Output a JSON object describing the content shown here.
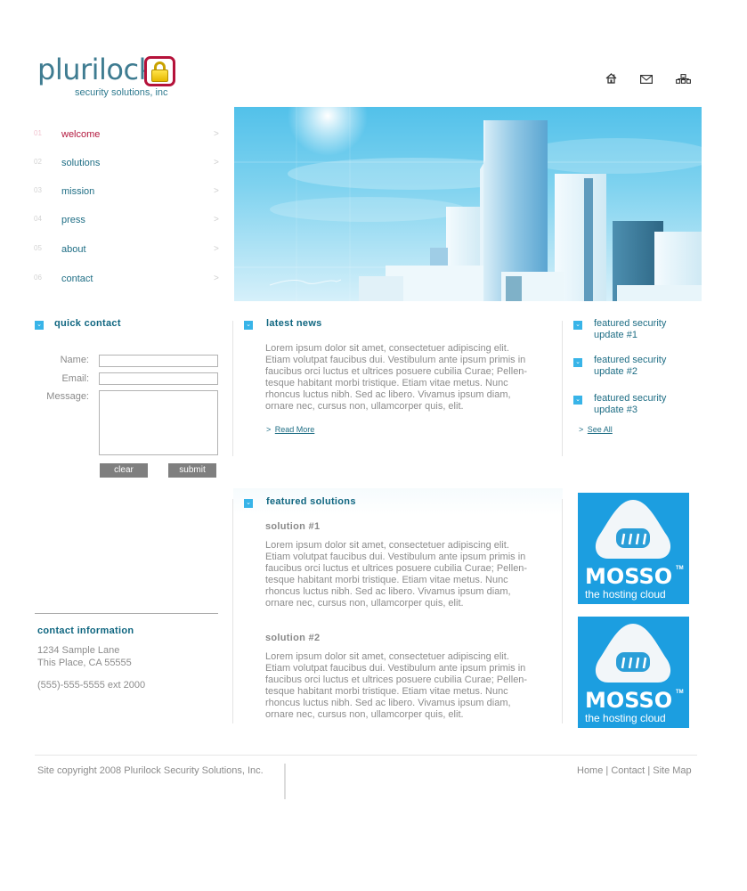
{
  "brand": {
    "name": "plurilock",
    "tagline": "security solutions, inc",
    "logo_icon": "padlock-icon",
    "colors": {
      "primary": "#1f6e85",
      "accent": "#b3183e",
      "highlight": "#38b4e8",
      "button": "#7f7f7f"
    }
  },
  "top_icons": [
    {
      "name": "home-icon",
      "label": "Home"
    },
    {
      "name": "mail-icon",
      "label": "Contact"
    },
    {
      "name": "sitemap-icon",
      "label": "Site Map"
    }
  ],
  "nav": [
    {
      "num": "01",
      "label": "welcome",
      "active": true
    },
    {
      "num": "02",
      "label": "solutions",
      "active": false
    },
    {
      "num": "03",
      "label": "mission",
      "active": false
    },
    {
      "num": "04",
      "label": "press",
      "active": false
    },
    {
      "num": "05",
      "label": "about",
      "active": false
    },
    {
      "num": "06",
      "label": "contact",
      "active": false
    }
  ],
  "nav_chevron": ">",
  "check_glyph": "⌄",
  "quick_contact": {
    "title": "quick contact",
    "fields": [
      {
        "label": "Name:",
        "value": ""
      },
      {
        "label": "Email:",
        "value": ""
      },
      {
        "label": "Message:",
        "value": ""
      }
    ],
    "clear_label": "clear",
    "submit_label": "submit"
  },
  "latest_news": {
    "title": "latest news",
    "body": "Lorem ipsum dolor sit amet, consectetuer adipiscing elit. Etiam volutpat faucibus dui. Vestibulum ante ipsum primis in faucibus orci luctus et ultrices posuere cubilia Curae; Pellen-tesque habitant morbi tristique. Etiam vitae metus. Nunc rhoncus luctus nibh. Sed ac libero. Vivamus ipsum diam, ornare nec, cursus non, ullamcorper quis, elit.",
    "lines": [
      "Lorem ipsum dolor sit amet, consectetuer adipiscing elit.",
      "Etiam volutpat faucibus dui. Vestibulum ante ipsum primis in",
      "faucibus orci luctus et ultrices posuere cubilia Curae; Pellen-",
      "tesque habitant morbi tristique. Etiam vitae metus. Nunc",
      "rhoncus luctus nibh. Sed ac libero. Vivamus ipsum diam,",
      "ornare nec, cursus non, ullamcorper quis, elit."
    ],
    "read_more": "Read More",
    "link_prefix": ">"
  },
  "updates": {
    "items": [
      {
        "line1": "featured security",
        "line2": "update #1"
      },
      {
        "line1": "featured security",
        "line2": "update #2"
      },
      {
        "line1": "featured security",
        "line2": "update #3"
      }
    ],
    "see_all": "See All"
  },
  "featured_solutions": {
    "title": "featured solutions",
    "solutions": [
      {
        "title": "solution #1",
        "lines": [
          "Lorem ipsum dolor sit amet, consectetuer adipiscing elit.",
          "Etiam volutpat faucibus dui. Vestibulum ante ipsum primis in",
          "faucibus orci luctus et ultrices posuere cubilia Curae; Pellen-",
          "tesque habitant morbi tristique. Etiam vitae metus. Nunc",
          "rhoncus luctus nibh. Sed ac libero. Vivamus ipsum diam,",
          "ornare nec, cursus non, ullamcorper quis, elit."
        ]
      },
      {
        "title": "solution #2",
        "lines": [
          "Lorem ipsum dolor sit amet, consectetuer adipiscing elit.",
          "Etiam volutpat faucibus dui. Vestibulum ante ipsum primis in",
          "faucibus orci luctus et ultrices posuere cubilia Curae; Pellen-",
          "tesque habitant morbi tristique. Etiam vitae metus. Nunc",
          "rhoncus luctus nibh. Sed ac libero. Vivamus ipsum diam,",
          "ornare nec, cursus non, ullamcorper quis, elit."
        ]
      }
    ]
  },
  "ads": [
    {
      "brand": "MOSSO",
      "tm": "TM",
      "tagline": "the hosting cloud",
      "reg": "®"
    },
    {
      "brand": "MOSSO",
      "tm": "TM",
      "tagline": "the hosting cloud",
      "reg": "®"
    }
  ],
  "contact_info": {
    "title": "contact information",
    "address1": "1234 Sample Lane",
    "address2": "This Place, CA 55555",
    "phone": "(555)-555-5555 ext 2000"
  },
  "footer": {
    "copyright": "Site copyright 2008 Plurilock Security Solutions, Inc.",
    "links": [
      "Home",
      "Contact",
      "Site Map"
    ],
    "separator": "|"
  }
}
